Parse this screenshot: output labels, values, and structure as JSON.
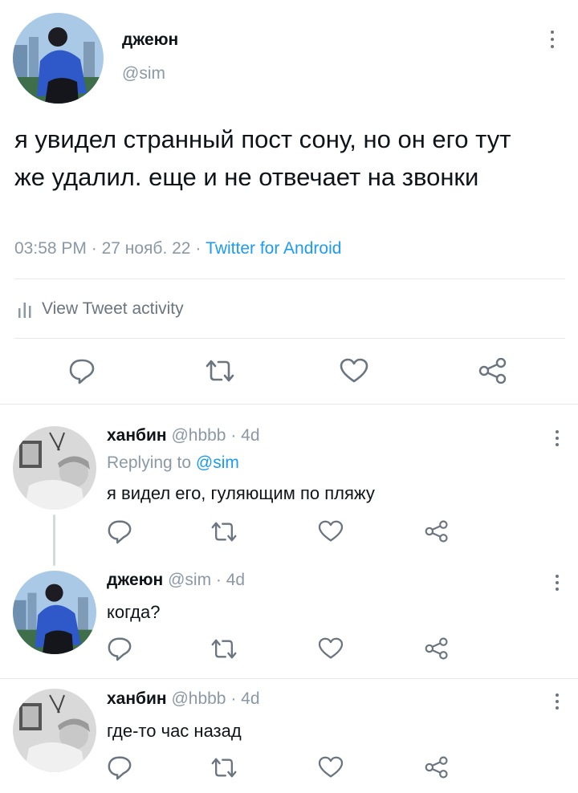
{
  "main_tweet": {
    "author_name": "джеюн",
    "author_handle": "@sim",
    "text": "я увидел странный пост сону, но он его тут же удалил. еще и не отвечает на звонки",
    "time": "03:58 PM",
    "sep1": "·",
    "date": "27 нояб. 22",
    "sep2": "·",
    "source": "Twitter for Android",
    "activity_label": "View Tweet activity"
  },
  "replies": [
    {
      "author_name": "ханбин",
      "author_handle": "@hbbb",
      "age": "· 4d",
      "replying_prefix": "Replying to",
      "replying_to": "@sim",
      "text": "я видел его, гуляющим по пляжу"
    },
    {
      "author_name": "джеюн",
      "author_handle": "@sim",
      "age": "· 4d",
      "text": "когда?"
    },
    {
      "author_name": "ханбин",
      "author_handle": "@hbbb",
      "age": "· 4d",
      "text": "где-то час назад"
    }
  ],
  "colors": {
    "accent": "#1d9bf0",
    "muted": "#8b98a5",
    "icon": "#6b7580",
    "divider": "#e6e9eb"
  },
  "icons": [
    "more-icon",
    "bar-chart-icon",
    "reply-icon",
    "retweet-icon",
    "like-icon",
    "share-icon"
  ]
}
